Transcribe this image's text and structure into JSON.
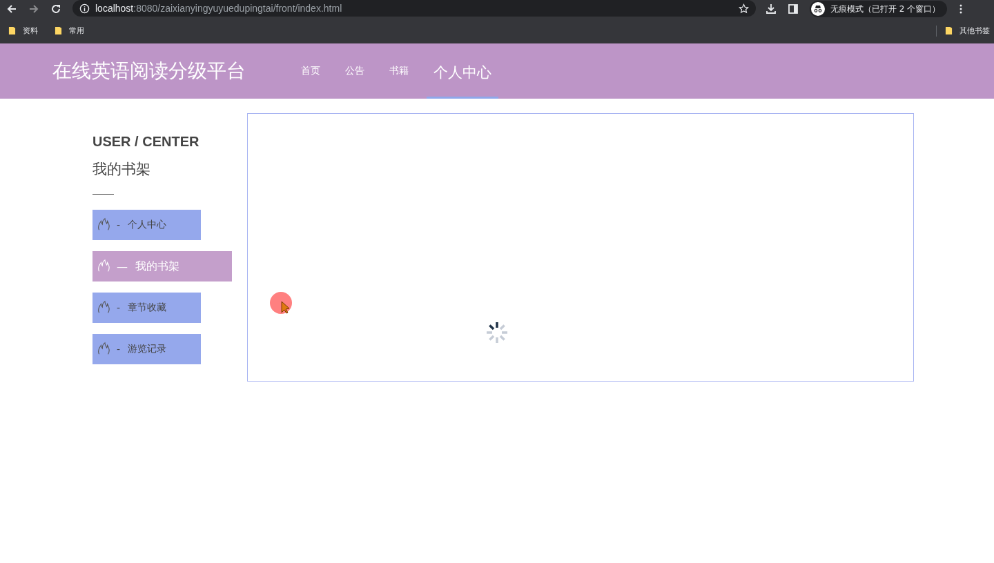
{
  "browser": {
    "url_host": "localhost",
    "url_path": ":8080/zaixianyingyuyuedupingtai/front/index.html",
    "incognito_label": "无痕模式（已打开 2 个窗口）",
    "bookmarks": [
      "资料",
      "常用"
    ],
    "other_bookmarks": "其他书签"
  },
  "header": {
    "title": "在线英语阅读分级平台",
    "nav": [
      {
        "label": "首页",
        "selected": false
      },
      {
        "label": "公告",
        "selected": false
      },
      {
        "label": "书籍",
        "selected": false
      },
      {
        "label": "个人中心",
        "selected": true
      }
    ]
  },
  "sidebar": {
    "heading": "USER / CENTER",
    "subtitle": "我的书架",
    "items": [
      {
        "label": "个人中心",
        "separator": "-",
        "selected": false
      },
      {
        "label": "我的书架",
        "separator": "—",
        "selected": true
      },
      {
        "label": "章节收藏",
        "separator": "-",
        "selected": false
      },
      {
        "label": "游览记录",
        "separator": "-",
        "selected": false
      }
    ]
  },
  "content": {
    "loading": true
  }
}
